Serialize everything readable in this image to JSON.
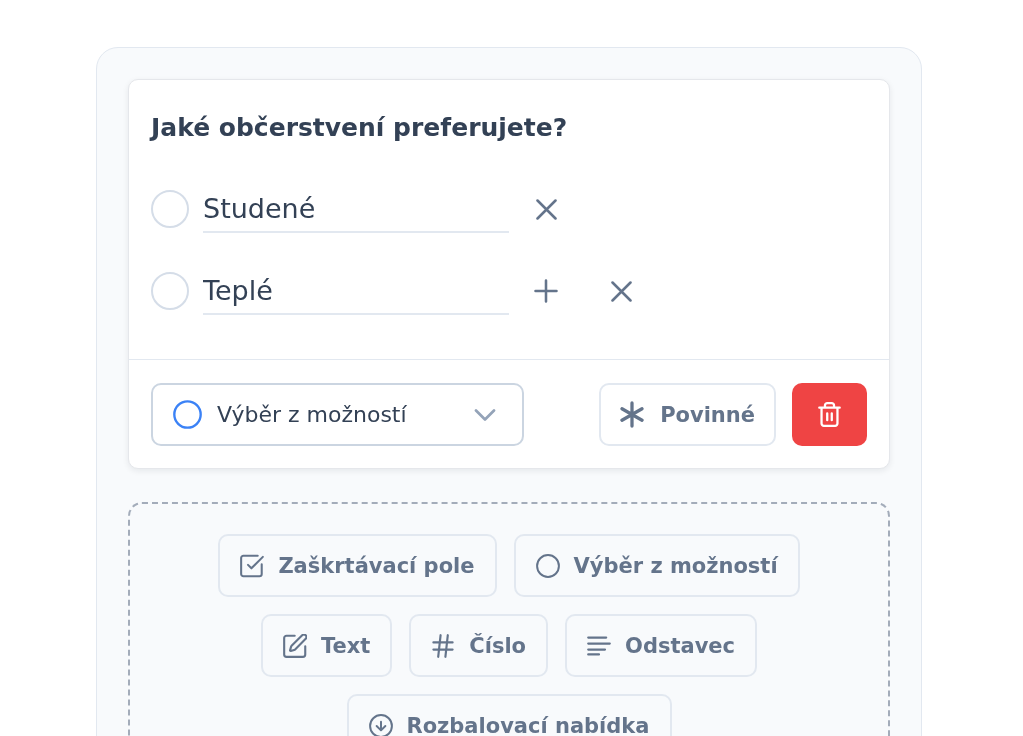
{
  "question": {
    "title": "Jaké občerstvení preferujete?",
    "options": [
      {
        "value": "Studené",
        "selected": false,
        "add_button": false
      },
      {
        "value": "Teplé",
        "selected": false,
        "add_button": true
      }
    ],
    "field_type": {
      "kind": "radio",
      "label": "Výběr z možností"
    },
    "required": {
      "label": "Povinné",
      "on": false
    }
  },
  "add_field_types": [
    {
      "kind": "checkbox",
      "label": "Zaškrtávací pole"
    },
    {
      "kind": "radio",
      "label": "Výběr z možností"
    },
    {
      "kind": "text",
      "label": "Text"
    },
    {
      "kind": "number",
      "label": "Číslo"
    },
    {
      "kind": "paragraph",
      "label": "Odstavec"
    },
    {
      "kind": "dropdown",
      "label": "Rozbalovací nabídka"
    }
  ]
}
